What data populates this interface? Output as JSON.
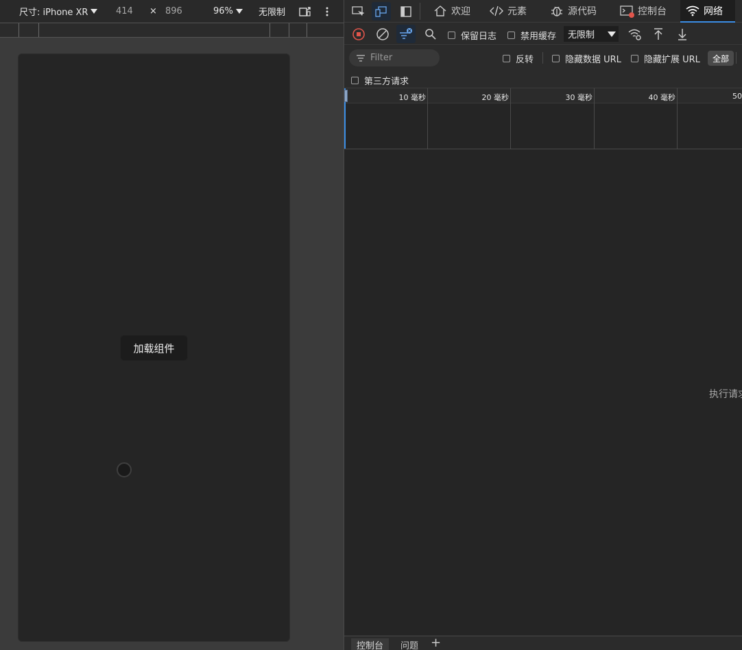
{
  "device_toolbar": {
    "size_label": "尺寸: iPhone XR",
    "width": "414",
    "times": "×",
    "height": "896",
    "zoom": "96%",
    "throttle": "无限制"
  },
  "device_page": {
    "load_button": "加载组件"
  },
  "devtools_tabs": {
    "welcome": "欢迎",
    "elements": "元素",
    "sources": "源代码",
    "console": "控制台",
    "network": "网络"
  },
  "network_toolbar": {
    "preserve_log": "保留日志",
    "disable_cache": "禁用缓存",
    "throttling": "无限制"
  },
  "filter_row": {
    "filter_placeholder": "Filter",
    "invert": "反转",
    "hide_data_urls": "隐藏数据 URL",
    "hide_extension_urls": "隐藏扩展 URL",
    "all": "全部",
    "third_party": "第三方请求"
  },
  "timeline": {
    "labels": [
      "10 毫秒",
      "20 毫秒",
      "30 毫秒",
      "40 毫秒",
      "50"
    ]
  },
  "empty_state": "执行请求",
  "drawer": {
    "console": "控制台",
    "issues": "问题",
    "add": "+"
  },
  "colors": {
    "accent": "#3b8ee6",
    "record": "#e0554b"
  }
}
